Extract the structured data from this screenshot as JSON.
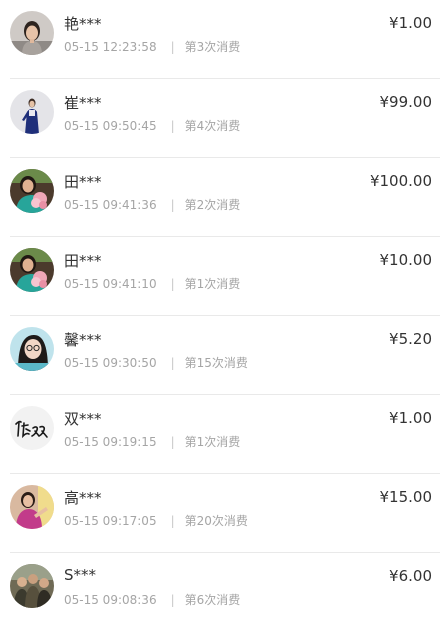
{
  "currency_symbol": "¥",
  "records": [
    {
      "name": "艳***",
      "time": "05-15 12:23:58",
      "count_label": "第3次消费",
      "amount": "1.00",
      "avatar_icon": "woman-portrait-avatar"
    },
    {
      "name": "崔***",
      "time": "05-15 09:50:45",
      "count_label": "第4次消费",
      "amount": "99.00",
      "avatar_icon": "woman-in-suit-avatar"
    },
    {
      "name": "田***",
      "time": "05-15 09:41:36",
      "count_label": "第2次消费",
      "amount": "100.00",
      "avatar_icon": "woman-with-flowers-avatar"
    },
    {
      "name": "田***",
      "time": "05-15 09:41:10",
      "count_label": "第1次消费",
      "amount": "10.00",
      "avatar_icon": "woman-with-flowers-avatar"
    },
    {
      "name": "馨***",
      "time": "05-15 09:30:50",
      "count_label": "第15次消费",
      "amount": "5.20",
      "avatar_icon": "girl-with-glasses-avatar"
    },
    {
      "name": "双***",
      "time": "05-15 09:19:15",
      "count_label": "第1次消费",
      "amount": "1.00",
      "avatar_icon": "calligraphy-avatar"
    },
    {
      "name": "高***",
      "time": "05-15 09:17:05",
      "count_label": "第20次消费",
      "amount": "15.00",
      "avatar_icon": "woman-pink-dress-avatar"
    },
    {
      "name": "S***",
      "time": "05-15 09:08:36",
      "count_label": "第6次消费",
      "amount": "6.00",
      "avatar_icon": "group-photo-avatar"
    }
  ],
  "colors": {
    "text_primary": "#333333",
    "text_secondary": "#a5a5a5",
    "divider": "#e9e9e9"
  }
}
